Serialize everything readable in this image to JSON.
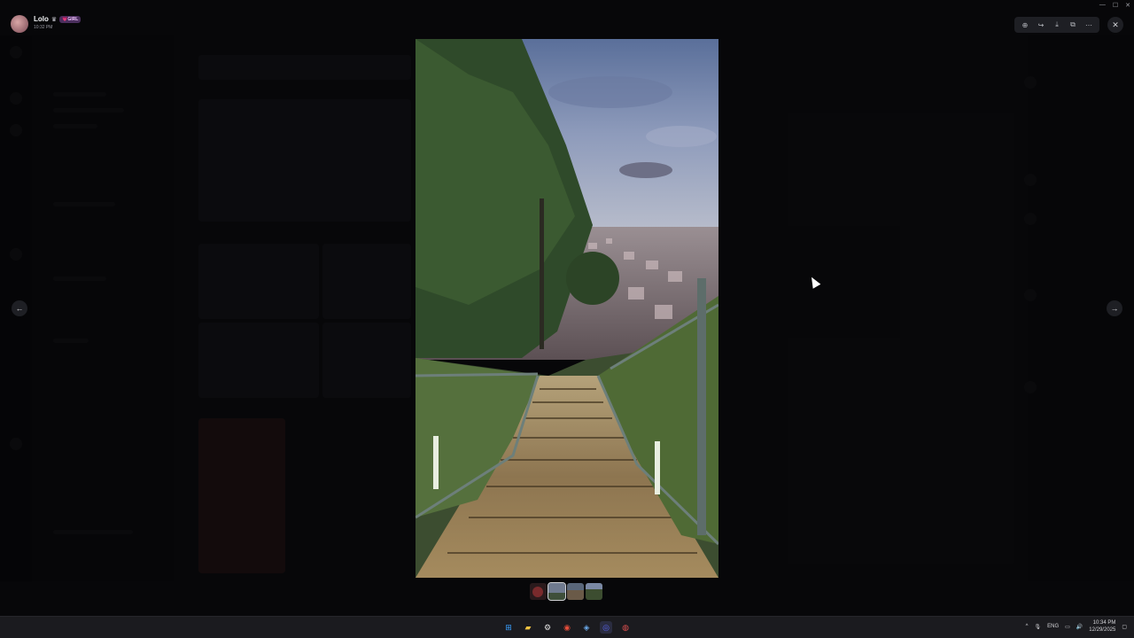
{
  "viewer": {
    "author_name": "Lolo",
    "author_badge_icon": "crown-icon",
    "author_tag": "💗GIRL",
    "timestamp": "10:32 PM",
    "toolbar": [
      {
        "name": "zoom-in-icon",
        "glyph": "⊕"
      },
      {
        "name": "forward-icon",
        "glyph": "↪"
      },
      {
        "name": "download-icon",
        "glyph": "⤓"
      },
      {
        "name": "open-in-browser-icon",
        "glyph": "⧉"
      },
      {
        "name": "more-options-icon",
        "glyph": "⋯"
      }
    ],
    "close_glyph": "✕",
    "prev_glyph": "←",
    "next_glyph": "→",
    "thumbnail_count": 4,
    "selected_thumbnail_index": 1
  },
  "window_controls": {
    "minimize": "—",
    "maximize": "☐",
    "close": "✕"
  },
  "taskbar": {
    "apps": [
      {
        "name": "windows-start-icon",
        "glyph": "⊞",
        "color": "#3aa0ff"
      },
      {
        "name": "file-explorer-icon",
        "glyph": "▰",
        "color": "#f5c542"
      },
      {
        "name": "settings-gear-icon",
        "glyph": "⚙",
        "color": "#e0e0e0"
      },
      {
        "name": "chrome-icon",
        "glyph": "◉",
        "color": "#e44d3a"
      },
      {
        "name": "steam-icon",
        "glyph": "◈",
        "color": "#6aa8e8"
      },
      {
        "name": "discord-icon",
        "glyph": "◎",
        "color": "#5865f2"
      },
      {
        "name": "app-icon",
        "glyph": "◍",
        "color": "#e05050"
      }
    ],
    "tray": {
      "chevron": "^",
      "language": "ENG",
      "time": "10:34 PM",
      "date": "12/29/2025"
    }
  },
  "colors": {
    "accent": "#5865f2",
    "background": "#000000"
  }
}
